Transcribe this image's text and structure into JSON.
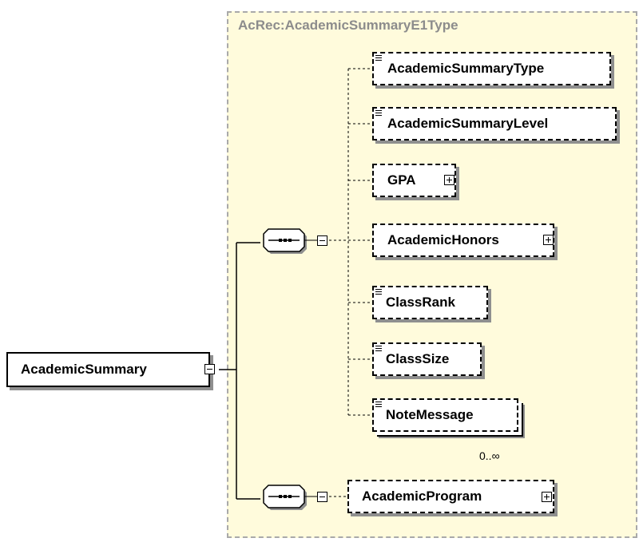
{
  "diagram": {
    "type_title": "AcRec:AcademicSummaryE1Type",
    "root": {
      "label": "AcademicSummary"
    },
    "elements": [
      {
        "label": "AcademicSummaryType"
      },
      {
        "label": "AcademicSummaryLevel"
      },
      {
        "label": "GPA"
      },
      {
        "label": "AcademicHonors"
      },
      {
        "label": "ClassRank"
      },
      {
        "label": "ClassSize"
      },
      {
        "label": "NoteMessage",
        "occurs": "0..∞"
      },
      {
        "label": "AcademicProgram"
      }
    ]
  },
  "colors": {
    "type_background": "#fffbdc",
    "type_border": "#a9a9a9",
    "title_text": "#8c8c8c",
    "shadow": "#8f8f8f"
  }
}
